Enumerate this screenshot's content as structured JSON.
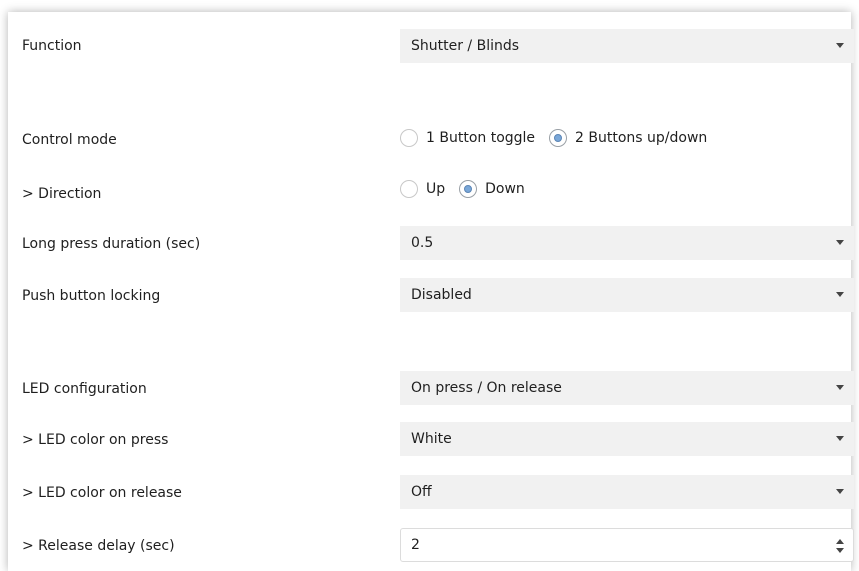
{
  "rows": {
    "function": {
      "label": "Function",
      "value": "Shutter / Blinds"
    },
    "control_mode": {
      "label": "Control mode",
      "options": [
        {
          "label": "1 Button toggle",
          "selected": false
        },
        {
          "label": "2 Buttons up/down",
          "selected": true
        }
      ]
    },
    "direction": {
      "label": "> Direction",
      "options": [
        {
          "label": "Up",
          "selected": false
        },
        {
          "label": "Down",
          "selected": true
        }
      ]
    },
    "long_press": {
      "label": "Long press duration (sec)",
      "value": "0.5"
    },
    "push_lock": {
      "label": "Push button locking",
      "value": "Disabled"
    },
    "led_config": {
      "label": "LED configuration",
      "value": "On press / On release"
    },
    "led_press": {
      "label": "> LED color on press",
      "value": "White"
    },
    "led_release": {
      "label": "> LED color on release",
      "value": "Off"
    },
    "release_delay": {
      "label": "> Release delay (sec)",
      "value": "2"
    }
  },
  "icons": {
    "dropdown": "chevron-down-icon",
    "spinner_up": "spin-up-icon",
    "spinner_down": "spin-down-icon",
    "radio": "radio-icon"
  }
}
